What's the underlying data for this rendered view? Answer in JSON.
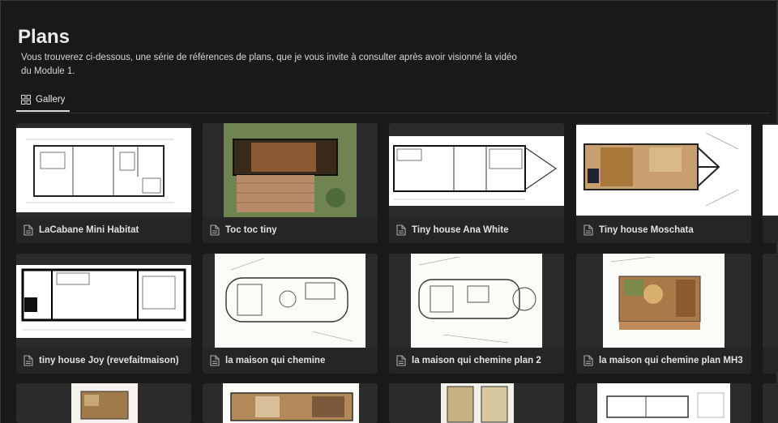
{
  "page": {
    "title": "Plans",
    "description": "Vous trouverez ci-dessous, une série de références de plans, que je vous invite à consulter après avoir visionné la vidéo du Module 1."
  },
  "tabs": [
    {
      "label": "Gallery",
      "icon": "gallery-grid-icon",
      "active": true
    }
  ],
  "cards": [
    {
      "title": "LaCabane Mini Habitat",
      "icon": "page-icon",
      "thumb": "floor-plan-drawing"
    },
    {
      "title": "Toc toc tiny",
      "icon": "page-icon",
      "thumb": "rendered-plan-with-deck"
    },
    {
      "title": "Tiny house Ana White",
      "icon": "page-icon",
      "thumb": "floor-plan-trailer"
    },
    {
      "title": "Tiny house Moschata",
      "icon": "page-icon",
      "thumb": "colored-plan-trailer"
    },
    {
      "title": "tiny house Joy (revefaitmaison)",
      "icon": "page-icon",
      "thumb": "floor-plan-drawing"
    },
    {
      "title": "la maison qui chemine",
      "icon": "page-icon",
      "thumb": "sketch-plan"
    },
    {
      "title": "la maison qui chemine plan 2",
      "icon": "page-icon",
      "thumb": "sketch-plan"
    },
    {
      "title": "la maison qui chemine plan MH3",
      "icon": "page-icon",
      "thumb": "colored-sketch-plan"
    }
  ],
  "colors": {
    "background": "#191919",
    "card": "#252525",
    "text": "#e6e6e6"
  }
}
